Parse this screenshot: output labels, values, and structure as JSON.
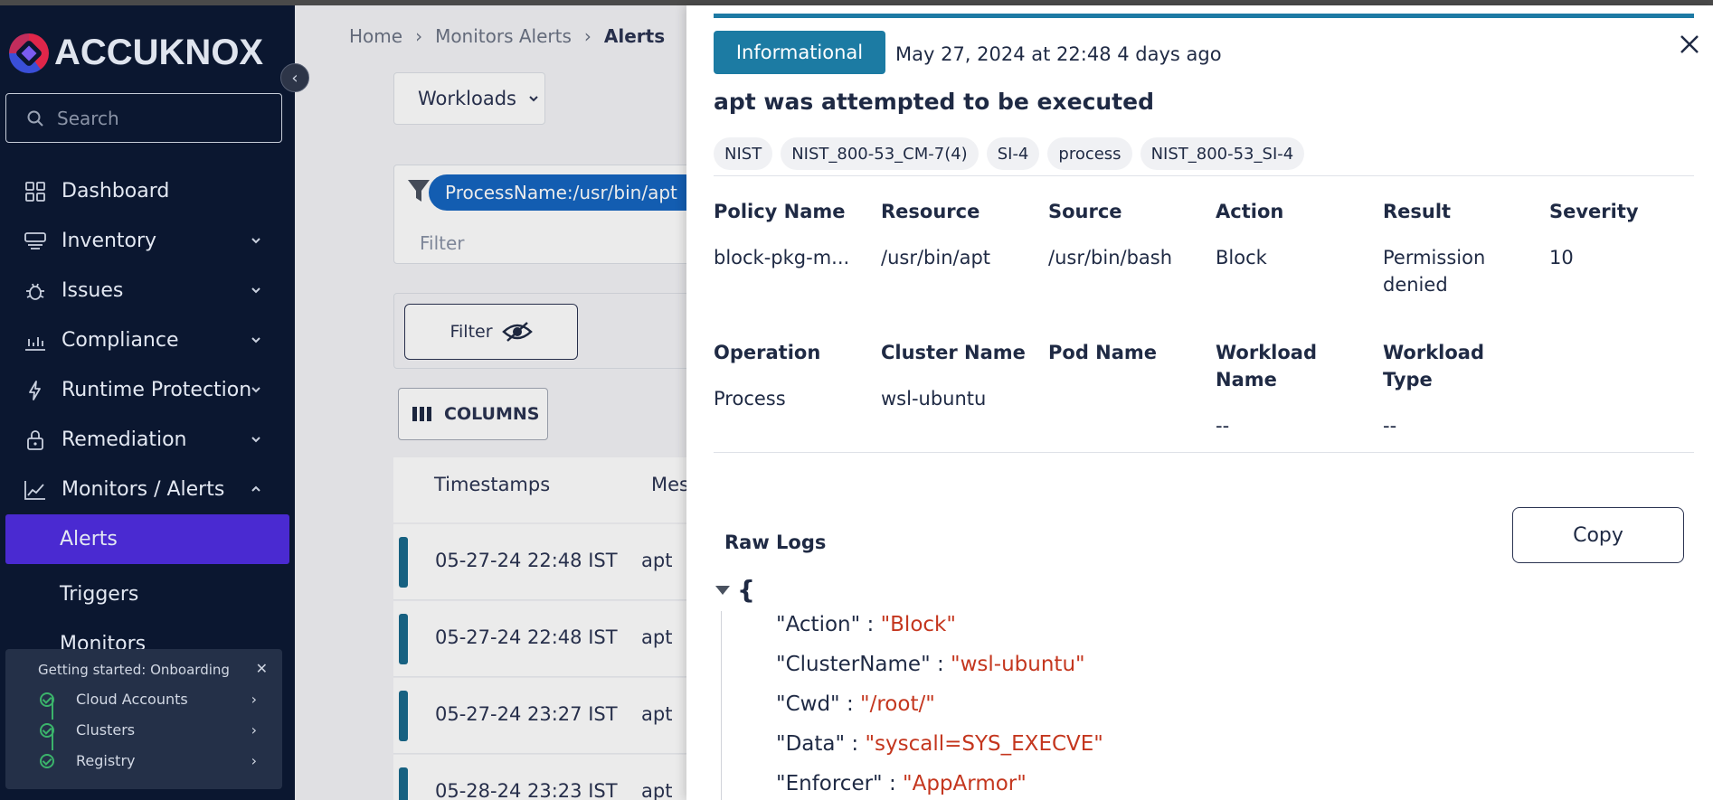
{
  "brand": {
    "name": "ACCUKNOX"
  },
  "sidebar": {
    "search_placeholder": "Search",
    "items": [
      {
        "label": "Dashboard"
      },
      {
        "label": "Inventory"
      },
      {
        "label": "Issues"
      },
      {
        "label": "Compliance"
      },
      {
        "label": "Runtime Protection"
      },
      {
        "label": "Remediation"
      },
      {
        "label": "Monitors / Alerts"
      }
    ],
    "subitems": [
      {
        "label": "Alerts",
        "active": true
      },
      {
        "label": "Triggers"
      },
      {
        "label": "Monitors"
      }
    ],
    "onboarding": {
      "title": "Getting started: Onboarding",
      "steps": [
        "Cloud Accounts",
        "Clusters",
        "Registry"
      ]
    }
  },
  "main": {
    "breadcrumb": [
      "Home",
      "Monitors Alerts",
      "Alerts"
    ],
    "workloads_label": "Workloads",
    "filter_pill": "ProcessName:/usr/bin/apt",
    "filter_placeholder": "Filter",
    "filter_button": "Filter",
    "columns_button": "COLUMNS",
    "table_headers": [
      "Timestamps",
      "Mes"
    ],
    "rows": [
      {
        "timestamp": "05-27-24 22:48 IST",
        "message": "apt"
      },
      {
        "timestamp": "05-27-24 22:48 IST",
        "message": "apt"
      },
      {
        "timestamp": "05-27-24 23:27 IST",
        "message": "apt"
      },
      {
        "timestamp": "05-28-24 23:23 IST",
        "message": "apt"
      }
    ]
  },
  "drawer": {
    "severity_badge": "Informational",
    "timestamp": "May 27, 2024 at 22:48 4 days ago",
    "title": "apt was attempted to be executed",
    "tags": [
      "NIST",
      "NIST_800-53_CM-7(4)",
      "SI-4",
      "process",
      "NIST_800-53_SI-4"
    ],
    "fields_row1": [
      {
        "label": "Policy Name",
        "value": "block-pkg-m..."
      },
      {
        "label": "Resource",
        "value": "/usr/bin/apt"
      },
      {
        "label": "Source",
        "value": "/usr/bin/bash"
      },
      {
        "label": "Action",
        "value": "Block"
      },
      {
        "label": "Result",
        "value": "Permission denied"
      },
      {
        "label": "Severity",
        "value": "10"
      }
    ],
    "fields_row2": [
      {
        "label": "Operation",
        "value": "Process"
      },
      {
        "label": "Cluster Name",
        "value": "wsl-ubuntu"
      },
      {
        "label": "Pod Name",
        "value": ""
      },
      {
        "label": "Workload Name",
        "value": "--"
      },
      {
        "label": "Workload Type",
        "value": "--"
      }
    ],
    "raw_logs_label": "Raw Logs",
    "copy_label": "Copy",
    "json_open": "{",
    "raw_logs": [
      {
        "key": "\"Action\"",
        "value": "\"Block\""
      },
      {
        "key": "\"ClusterName\"",
        "value": "\"wsl-ubuntu\""
      },
      {
        "key": "\"Cwd\"",
        "value": "\"/root/\""
      },
      {
        "key": "\"Data\"",
        "value": "\"syscall=SYS_EXECVE\""
      },
      {
        "key": "\"Enforcer\"",
        "value": "\"AppArmor\""
      }
    ],
    "colors": {
      "accent": "#1c7ba3",
      "json_value": "#c4361e",
      "active_nav": "#4a2ad1"
    }
  }
}
